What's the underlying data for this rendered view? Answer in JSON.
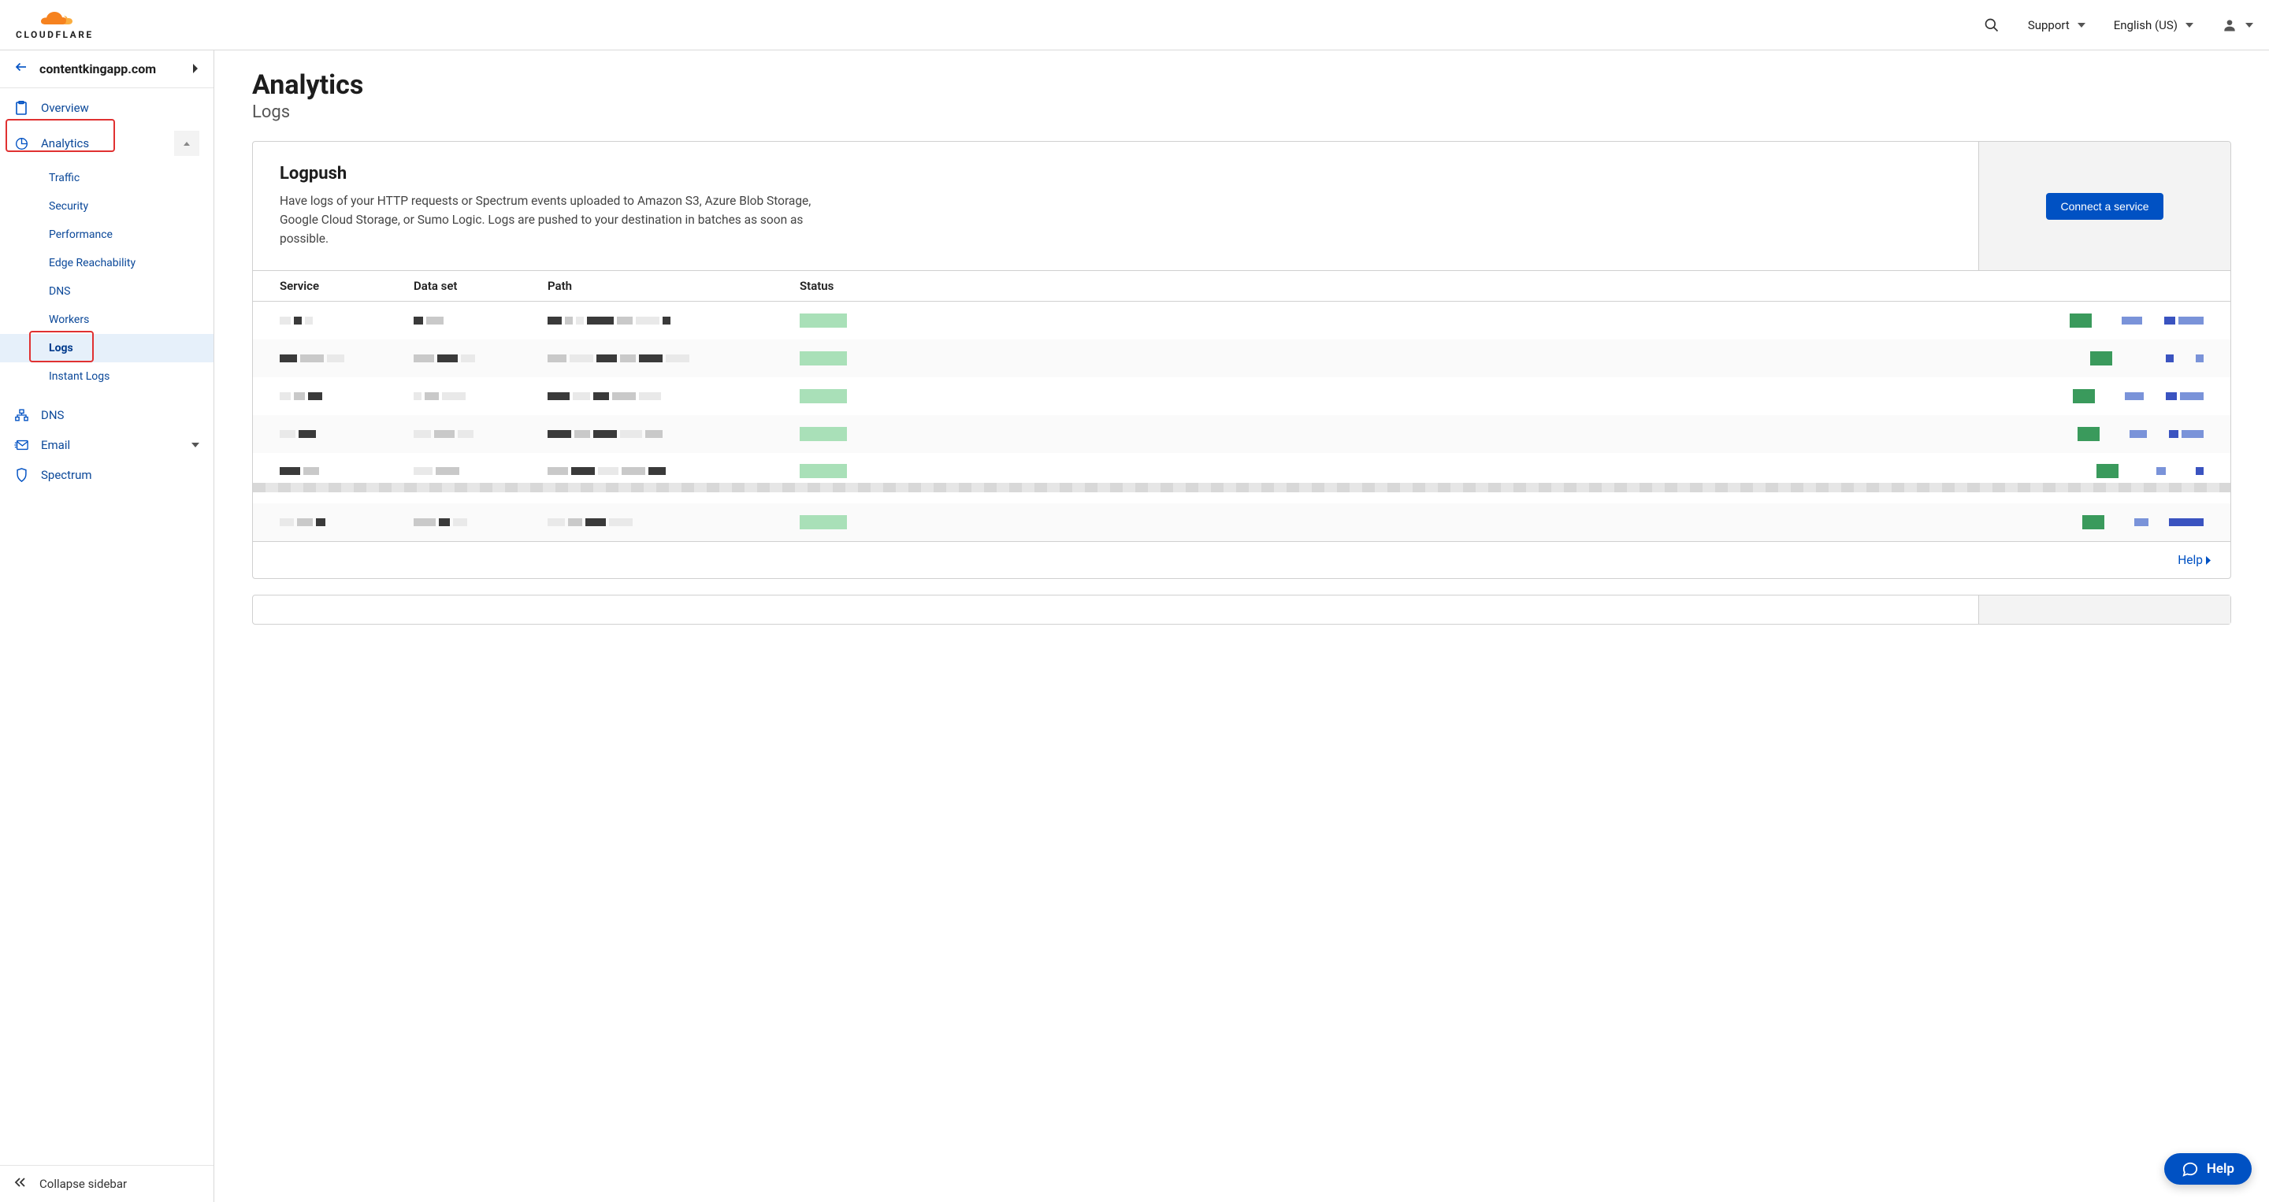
{
  "header": {
    "brand": "CLOUDFLARE",
    "support": "Support",
    "language": "English (US)"
  },
  "sidebar": {
    "domain": "contentkingapp.com",
    "items": {
      "overview": "Overview",
      "analytics": "Analytics",
      "dns": "DNS",
      "email": "Email",
      "spectrum": "Spectrum"
    },
    "analytics_sub": {
      "traffic": "Traffic",
      "security": "Security",
      "performance": "Performance",
      "edge": "Edge Reachability",
      "dns": "DNS",
      "workers": "Workers",
      "logs": "Logs",
      "instant": "Instant Logs"
    },
    "collapse": "Collapse sidebar"
  },
  "page": {
    "title": "Analytics",
    "subtitle": "Logs",
    "logpush": {
      "title": "Logpush",
      "desc": "Have logs of your HTTP requests or Spectrum events uploaded to Amazon S3, Azure Blob Storage, Google Cloud Storage, or Sumo Logic. Logs are pushed to your destination in batches as soon as possible.",
      "cta": "Connect a service",
      "cols": {
        "service": "Service",
        "dataset": "Data set",
        "path": "Path",
        "status": "Status"
      },
      "help": "Help"
    }
  },
  "fab": {
    "label": "Help"
  }
}
